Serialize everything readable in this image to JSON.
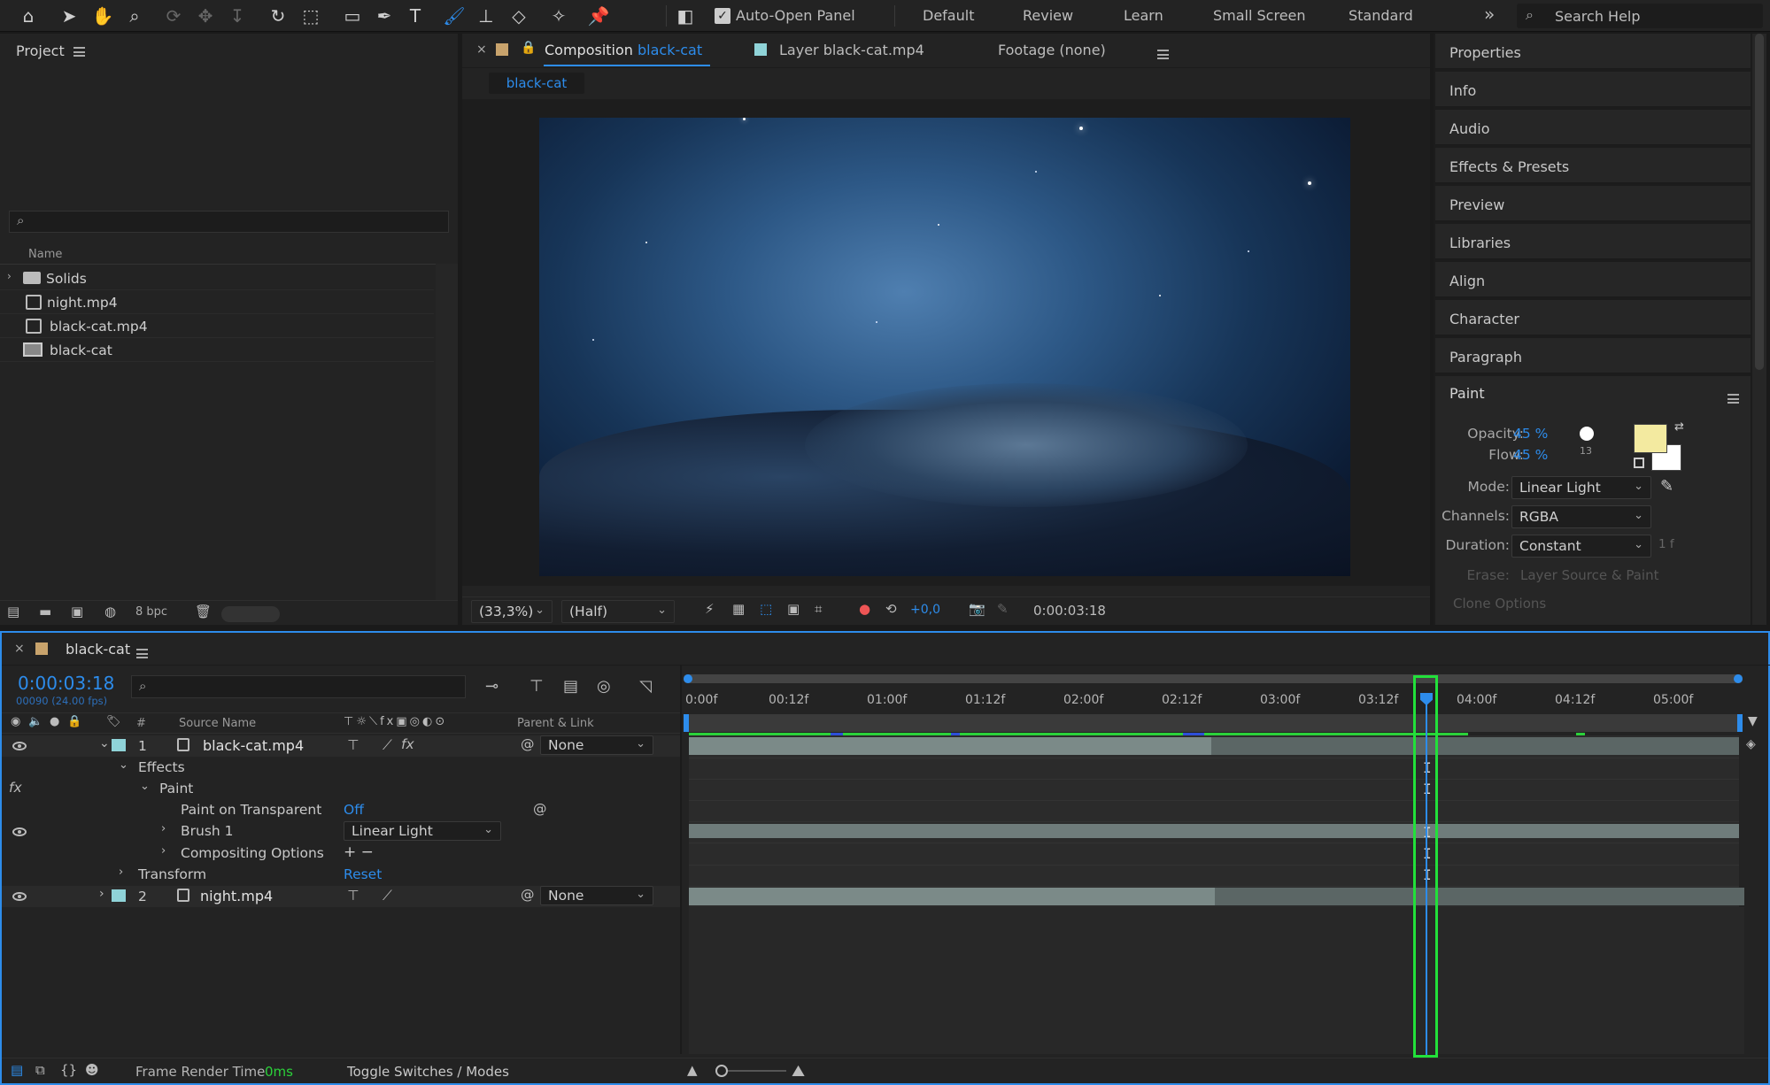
{
  "toolbar": {
    "auto_open_label": "Auto-Open Panel",
    "workspaces": [
      "Default",
      "Review",
      "Learn",
      "Small Screen",
      "Standard"
    ],
    "more": "»",
    "search_placeholder": "Search Help"
  },
  "project": {
    "title": "Project",
    "search_value": "",
    "column_name": "Name",
    "items": [
      {
        "name": "Solids",
        "type": "folder"
      },
      {
        "name": "night.mp4",
        "type": "footage"
      },
      {
        "name": "black-cat.mp4",
        "type": "footage"
      },
      {
        "name": "black-cat",
        "type": "composition"
      }
    ],
    "bpc": "8 bpc"
  },
  "viewer": {
    "tabs": [
      {
        "label": "Composition",
        "name": "black-cat"
      },
      {
        "label": "Layer",
        "name": "black-cat.mp4"
      },
      {
        "label": "Footage (none)"
      }
    ],
    "flow_chip": "black-cat",
    "zoom": "(33,3%)",
    "resolution": "(Half)",
    "exposure": "+0,0",
    "timecode": "0:00:03:18"
  },
  "right_panels": [
    "Properties",
    "Info",
    "Audio",
    "Effects & Presets",
    "Preview",
    "Libraries",
    "Align",
    "Character",
    "Paragraph"
  ],
  "paint": {
    "title": "Paint",
    "opacity_label": "Opacity:",
    "opacity_value": "45 %",
    "flow_label": "Flow:",
    "flow_value": "45 %",
    "brush_size": "13",
    "fg_color": "#f3eaa0",
    "bg_color": "#ffffff",
    "mode_label": "Mode:",
    "mode_value": "Linear Light",
    "channels_label": "Channels:",
    "channels_value": "RGBA",
    "duration_label": "Duration:",
    "duration_value": "Constant",
    "duration_frames": "1 f",
    "erase_label": "Erase:",
    "erase_value": "Layer Source & Paint",
    "clone_label": "Clone Options"
  },
  "timeline": {
    "comp_name": "black-cat",
    "timecode": "0:00:03:18",
    "frame_info": "00090 (24.00 fps)",
    "search_value": "",
    "col_number": "#",
    "col_source": "Source Name",
    "col_parent": "Parent & Link",
    "ticks": [
      "0:00f",
      "00:12f",
      "01:00f",
      "01:12f",
      "02:00f",
      "02:12f",
      "03:00f",
      "03:12f",
      "04:00f",
      "04:12f",
      "05:00f"
    ],
    "layers": [
      {
        "num": "1",
        "name": "black-cat.mp4",
        "parent": "None"
      },
      {
        "num": "2",
        "name": "night.mp4",
        "parent": "None"
      }
    ],
    "effects_label": "Effects",
    "paint_label": "Paint",
    "paint_on_transparent_label": "Paint on Transparent",
    "paint_on_transparent_value": "Off",
    "brush_label": "Brush 1",
    "brush_mode": "Linear Light",
    "compositing_label": "Compositing Options",
    "compositing_value": "+ −",
    "transform_label": "Transform",
    "transform_value": "Reset",
    "fx_label": "fx"
  },
  "status": {
    "render_label": "Frame Render Time",
    "render_value": "0ms",
    "toggle_label": "Toggle Switches / Modes"
  }
}
